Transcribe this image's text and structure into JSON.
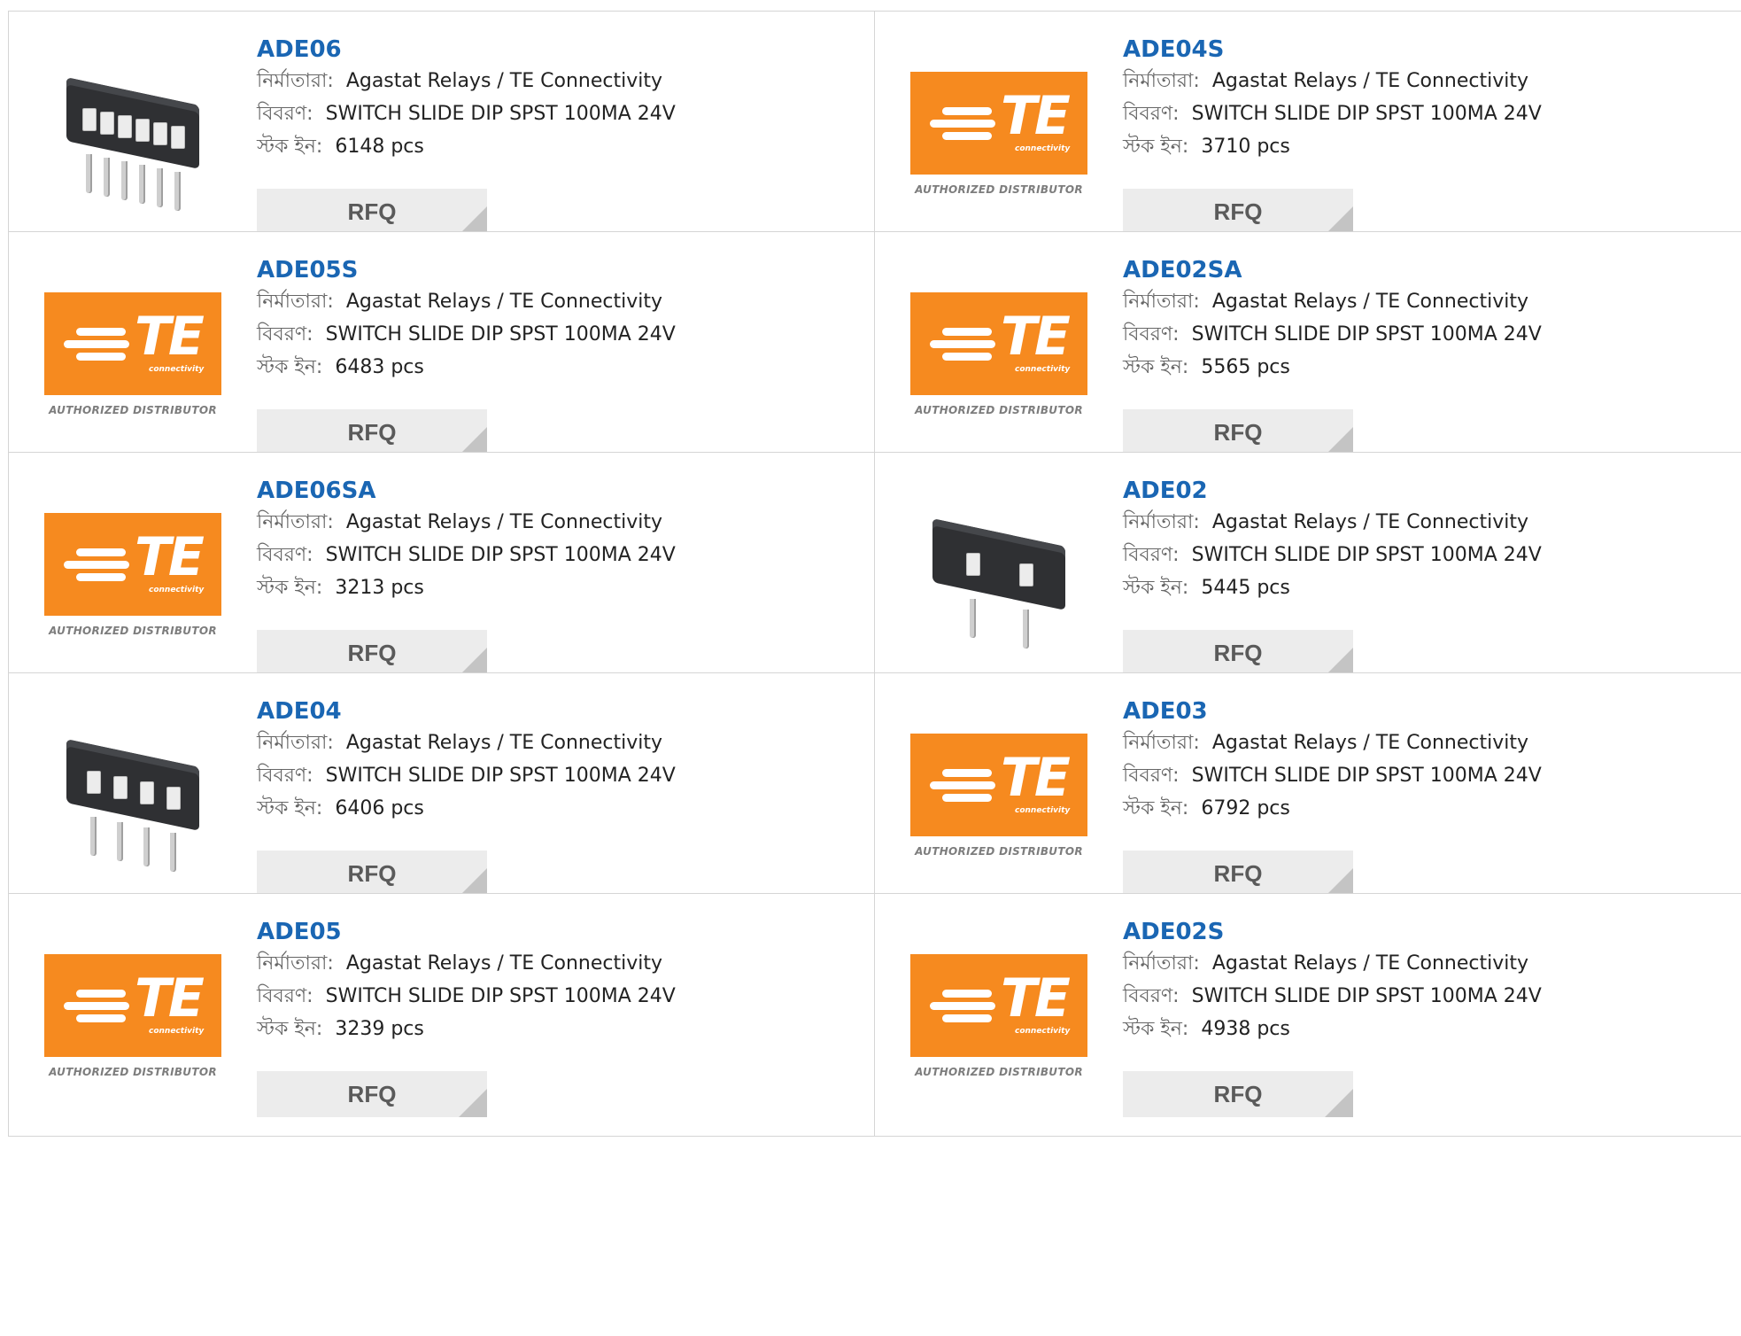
{
  "labels": {
    "manufacturer": "নির্মাতারা:",
    "description": "বিবরণ:",
    "stock": "স্টক ইন:",
    "rfq": "RFQ",
    "te_letters": "TE",
    "te_sub": "connectivity",
    "authorized": "AUTHORIZED DISTRIBUTOR"
  },
  "colors": {
    "te_orange": "#f68a1f",
    "title_blue": "#1a66b3",
    "rfq_bg": "#ececec"
  },
  "products": [
    {
      "part": "ADE06",
      "manufacturer": "Agastat Relays / TE Connectivity",
      "description": "SWITCH SLIDE DIP SPST 100MA 24V",
      "stock": "6148 pcs",
      "image": "dip-switch-6"
    },
    {
      "part": "ADE04S",
      "manufacturer": "Agastat Relays / TE Connectivity",
      "description": "SWITCH SLIDE DIP SPST 100MA 24V",
      "stock": "3710 pcs",
      "image": "te-logo"
    },
    {
      "part": "ADE05S",
      "manufacturer": "Agastat Relays / TE Connectivity",
      "description": "SWITCH SLIDE DIP SPST 100MA 24V",
      "stock": "6483 pcs",
      "image": "te-logo"
    },
    {
      "part": "ADE02SA",
      "manufacturer": "Agastat Relays / TE Connectivity",
      "description": "SWITCH SLIDE DIP SPST 100MA 24V",
      "stock": "5565 pcs",
      "image": "te-logo"
    },
    {
      "part": "ADE06SA",
      "manufacturer": "Agastat Relays / TE Connectivity",
      "description": "SWITCH SLIDE DIP SPST 100MA 24V",
      "stock": "3213 pcs",
      "image": "te-logo"
    },
    {
      "part": "ADE02",
      "manufacturer": "Agastat Relays / TE Connectivity",
      "description": "SWITCH SLIDE DIP SPST 100MA 24V",
      "stock": "5445 pcs",
      "image": "dip-switch-2"
    },
    {
      "part": "ADE04",
      "manufacturer": "Agastat Relays / TE Connectivity",
      "description": "SWITCH SLIDE DIP SPST 100MA 24V",
      "stock": "6406 pcs",
      "image": "dip-switch-4"
    },
    {
      "part": "ADE03",
      "manufacturer": "Agastat Relays / TE Connectivity",
      "description": "SWITCH SLIDE DIP SPST 100MA 24V",
      "stock": "6792 pcs",
      "image": "te-logo"
    },
    {
      "part": "ADE05",
      "manufacturer": "Agastat Relays / TE Connectivity",
      "description": "SWITCH SLIDE DIP SPST 100MA 24V",
      "stock": "3239 pcs",
      "image": "te-logo"
    },
    {
      "part": "ADE02S",
      "manufacturer": "Agastat Relays / TE Connectivity",
      "description": "SWITCH SLIDE DIP SPST 100MA 24V",
      "stock": "4938 pcs",
      "image": "te-logo"
    }
  ]
}
